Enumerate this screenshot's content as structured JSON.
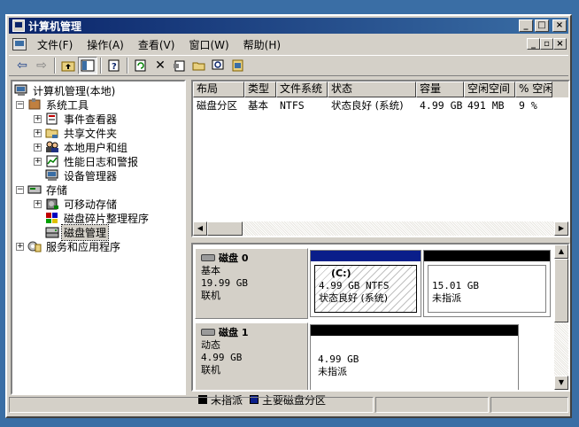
{
  "window": {
    "title": "计算机管理"
  },
  "menu": [
    "文件(F)",
    "操作(A)",
    "查看(V)",
    "窗口(W)",
    "帮助(H)"
  ],
  "toolbar_icons": [
    "back-icon",
    "forward-icon",
    "up-icon",
    "show-hide-tree-icon",
    "help-icon",
    "refresh-icon",
    "delete-icon",
    "properties-icon",
    "open-icon",
    "find-icon",
    "export-icon"
  ],
  "tree": {
    "root": "计算机管理(本地)",
    "system_tools": "系统工具",
    "event_viewer": "事件查看器",
    "shared_folders": "共享文件夹",
    "local_users": "本地用户和组",
    "perf_logs": "性能日志和警报",
    "device_manager": "设备管理器",
    "storage": "存储",
    "removable_storage": "可移动存储",
    "defrag": "磁盘碎片整理程序",
    "disk_mgmt": "磁盘管理",
    "services_apps": "服务和应用程序"
  },
  "volume_list": {
    "columns": [
      "布局",
      "类型",
      "文件系统",
      "状态",
      "容量",
      "空闲空间",
      "% 空闲"
    ],
    "rows": [
      [
        "磁盘分区",
        "基本",
        "NTFS",
        "状态良好 (系统)",
        "4.99 GB",
        "491 MB",
        "9 %"
      ]
    ]
  },
  "disks": [
    {
      "name": "磁盘 0",
      "type": "基本",
      "size": "19.99 GB",
      "status": "联机",
      "partitions": [
        {
          "title": "(C:)",
          "size": "4.99 GB NTFS",
          "status": "状态良好 (系统)",
          "bar_color": "#0a1e8a"
        },
        {
          "title": "",
          "size": "15.01 GB",
          "status": "未指派",
          "bar_color": "#000000"
        }
      ]
    },
    {
      "name": "磁盘 1",
      "type": "动态",
      "size": "4.99 GB",
      "status": "联机",
      "partitions": [
        {
          "title": "",
          "size": "4.99 GB",
          "status": "未指派",
          "bar_color": "#000000"
        }
      ]
    }
  ],
  "legend": [
    {
      "label": "未指派",
      "color": "#000000"
    },
    {
      "label": "主要磁盘分区",
      "color": "#0a1e8a"
    }
  ],
  "colors": {
    "title_bar": "#0a246a",
    "desktop": "#3a6ea5",
    "face": "#d4d0c8"
  }
}
